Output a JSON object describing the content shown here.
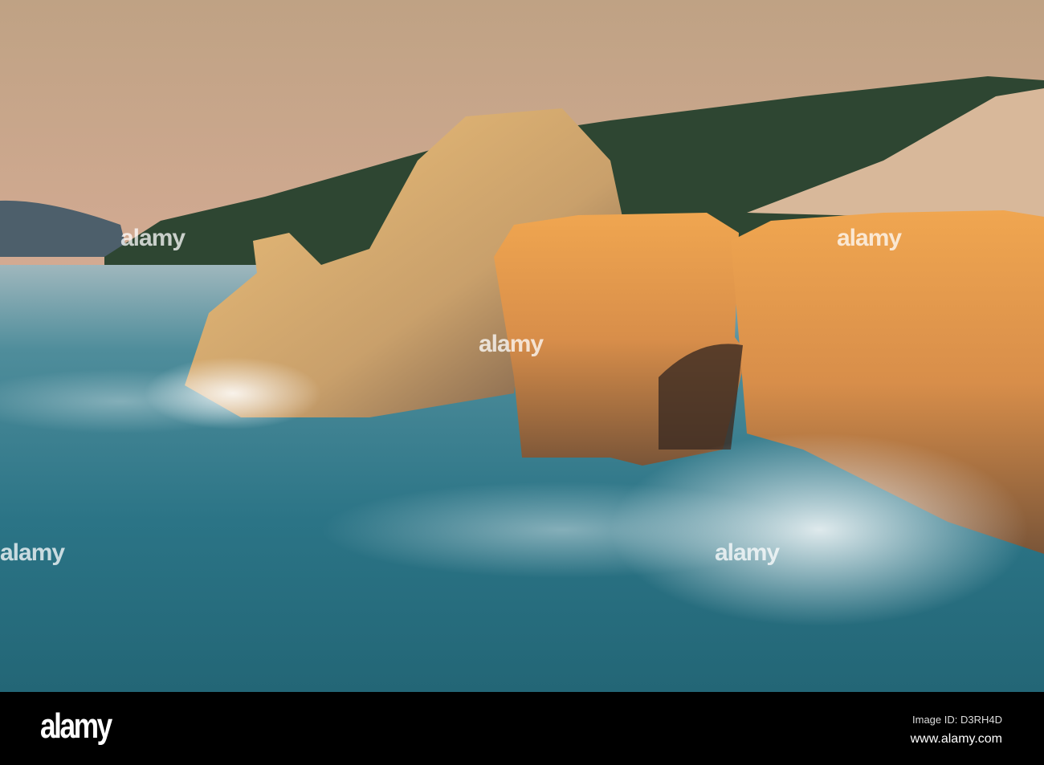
{
  "photo": {
    "subject": "coastal sandstone cliffs with crashing waves at sunset",
    "watermark": "alamy"
  },
  "footer": {
    "logo": "alamy",
    "image_id": "Image ID: D3RH4D",
    "url": "www.alamy.com"
  },
  "colors": {
    "sky_top": "#c9a98a",
    "sky_bottom": "#e3b6a6",
    "sea": "#2e7a8c",
    "rock": "#d99a55",
    "hill": "#2f4a33"
  }
}
